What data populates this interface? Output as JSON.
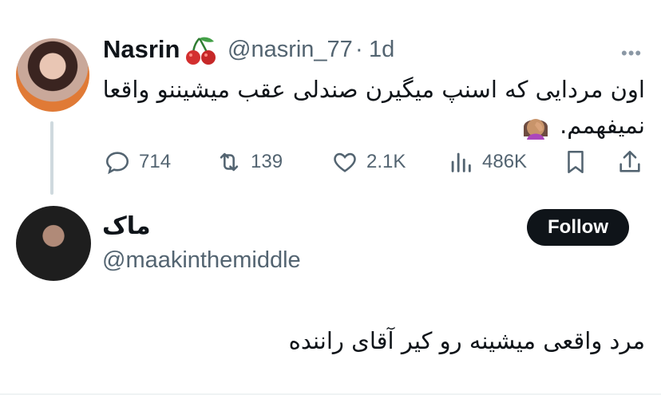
{
  "tweet": {
    "author_name": "Nasrin",
    "handle": "@nasrin_77",
    "separator": "·",
    "time": "1d",
    "text": "اون مردایی که اسنپ میگیرن صندلی عقب میشیننو واقعا نمیفهمم.",
    "stats": {
      "replies": "714",
      "reposts": "139",
      "likes": "2.1K",
      "views": "486K"
    }
  },
  "reply": {
    "author_name": "ماک",
    "handle": "@maakinthemiddle",
    "follow_label": "Follow",
    "text": "مرد واقعی میشینه رو کیر آقای راننده"
  },
  "icons": [
    "cherries-icon",
    "facepalm-emoji",
    "reply-icon",
    "repost-icon",
    "like-icon",
    "views-icon",
    "bookmark-icon",
    "share-icon",
    "more-icon"
  ],
  "colors": {
    "muted": "#536471",
    "text": "#0f1419",
    "button_bg": "#0f1419",
    "thread_line": "#cfd9de"
  }
}
